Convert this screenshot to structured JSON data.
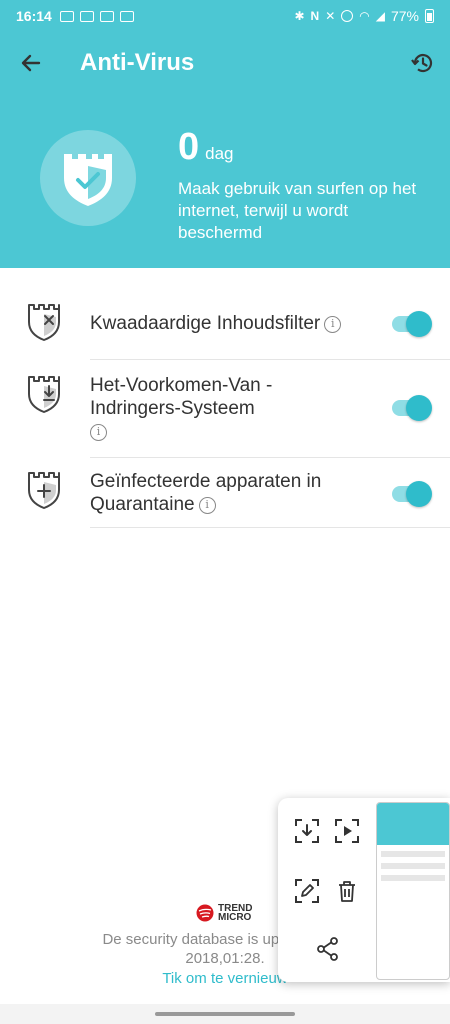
{
  "status": {
    "time": "16:14",
    "battery": "77%"
  },
  "header": {
    "title": "Anti-Virus",
    "days_value": "0",
    "days_unit": "dag",
    "description": "Maak gebruik van surfen op het internet, terwijl u wordt beschermd"
  },
  "features": [
    {
      "label": "Kwaadaardige Inhoudsfilter",
      "icon": "shield-x-icon",
      "enabled": true
    },
    {
      "label": "Het-Voorkomen-Van -Indringers-Systeem",
      "icon": "shield-download-icon",
      "enabled": true
    },
    {
      "label": "Geïnfecteerde apparaten in Quarantaine",
      "icon": "shield-plus-icon",
      "enabled": true
    }
  ],
  "footer": {
    "brand": "TREND MICRO",
    "db_status": "De security database is up-to-date m",
    "db_date": "2018,01:28.",
    "update_link": "Tik om te vernieuw"
  },
  "colors": {
    "accent": "#4cc7d3",
    "toggle_on": "#2fbccb"
  }
}
